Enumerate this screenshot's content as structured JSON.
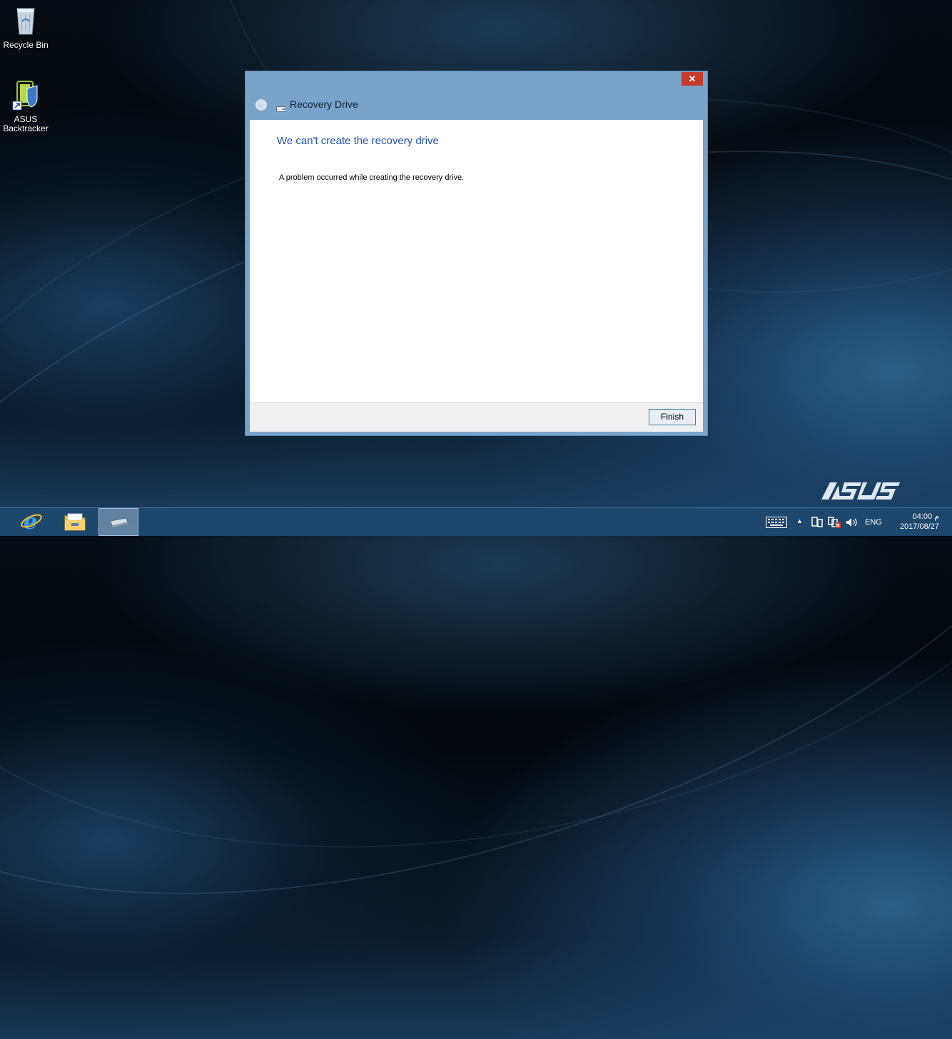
{
  "desktop": {
    "icons": [
      {
        "label": "Recycle Bin",
        "icon": "recycle-bin-icon"
      },
      {
        "label_line1": "ASUS",
        "label_line2": "Backtracker",
        "icon": "asus-backtracker-icon"
      }
    ],
    "brand": "/ISUS"
  },
  "dialog": {
    "title": "Recovery Drive",
    "close_label": "✕",
    "heading": "We can't create the recovery drive",
    "message": "A problem occurred while creating the recovery drive.",
    "finish_label": "Finish"
  },
  "taskbar": {
    "apps": [
      {
        "name": "internet-explorer",
        "icon": "ie-icon"
      },
      {
        "name": "file-explorer",
        "icon": "folder-icon"
      },
      {
        "name": "recovery-drive",
        "icon": "drive-icon",
        "active": true
      }
    ],
    "tray": {
      "language": "ENG",
      "time": "04:00 م",
      "date": "2017/08/27"
    }
  },
  "colors": {
    "accent_heading": "#1f4fb0",
    "dialog_frame": "#7aa3c9",
    "close_button": "#c7392b",
    "taskbar": "#1e486e"
  }
}
